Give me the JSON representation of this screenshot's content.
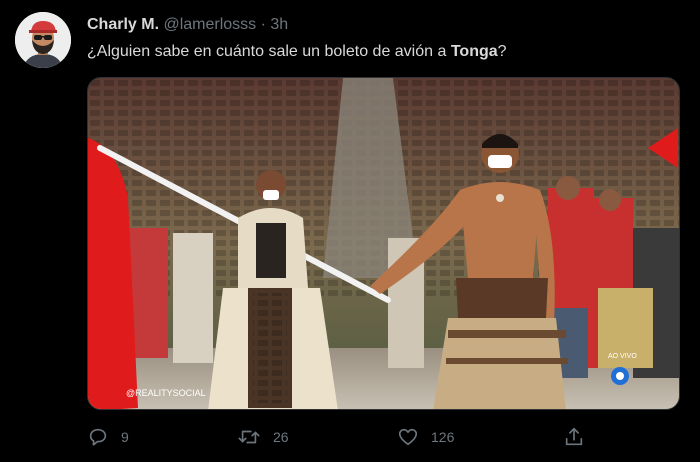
{
  "tweet": {
    "author_name": "Charly M.",
    "handle": "@lamerlosss",
    "separator": "·",
    "time": "3h",
    "text_before": "¿Alguien sabe en cuánto sale un boleto de avión a ",
    "text_bold": "Tonga",
    "text_after": "?",
    "media_watermark": "@REALITYSOCIAL",
    "media_channel": "AO VIVO"
  },
  "actions": {
    "reply_count": "9",
    "retweet_count": "26",
    "like_count": "126"
  },
  "icons": {
    "reply": "reply-icon",
    "retweet": "retweet-icon",
    "like": "heart-icon",
    "share": "share-icon"
  },
  "colors": {
    "background": "#000000",
    "text": "#d9d9d9",
    "muted": "#6e767d",
    "border": "#2f3336"
  }
}
